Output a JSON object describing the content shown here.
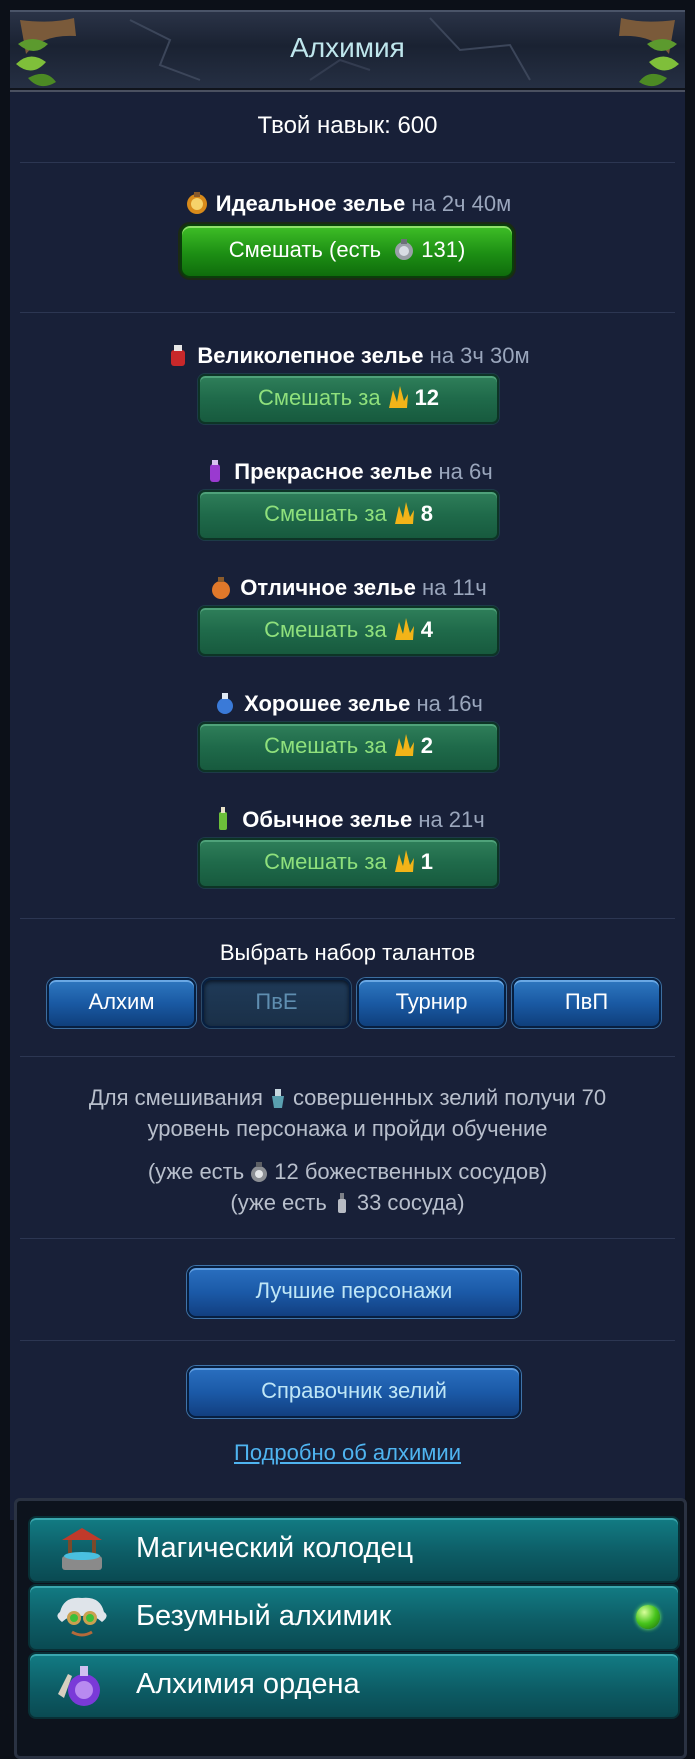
{
  "header": {
    "title": "Алхимия"
  },
  "skill_text": "Твой навык: 600",
  "ideal": {
    "name": "Идеальное зелье",
    "duration": "на 2ч 40м",
    "button_label": "Смешать (есть",
    "button_count": "131)"
  },
  "potions": [
    {
      "name": "Великолепное зелье",
      "duration": "на 3ч 30м",
      "button_label": "Смешать за",
      "cost": "12",
      "icon": "red-potion-icon"
    },
    {
      "name": "Прекрасное зелье",
      "duration": "на 6ч",
      "button_label": "Смешать за",
      "cost": "8",
      "icon": "purple-potion-icon"
    },
    {
      "name": "Отличное зелье",
      "duration": "на 11ч",
      "button_label": "Смешать за",
      "cost": "4",
      "icon": "orange-potion-icon"
    },
    {
      "name": "Хорошее зелье",
      "duration": "на 16ч",
      "button_label": "Смешать за",
      "cost": "2",
      "icon": "blue-potion-icon"
    },
    {
      "name": "Обычное зелье",
      "duration": "на 21ч",
      "button_label": "Смешать за",
      "cost": "1",
      "icon": "green-potion-icon"
    }
  ],
  "talents": {
    "title": "Выбрать набор талантов",
    "buttons": [
      "Алхим",
      "ПвЕ",
      "Турнир",
      "ПвП"
    ],
    "active": "ПвЕ"
  },
  "info": {
    "line1_a": "Для смешивания",
    "line1_b": "совершенных зелий получи 70",
    "line2": "уровень персонажа и пройди обучение",
    "line3_a": "(уже есть",
    "line3_b": "12 божественных сосудов)",
    "line4_a": "(уже есть",
    "line4_b": "33 сосуда)"
  },
  "buttons": {
    "best_characters": "Лучшие персонажи",
    "potion_guide": "Справочник зелий",
    "more_link": "Подробно об алхимии"
  },
  "menu": [
    {
      "label": "Магический колодец",
      "icon": "magic-well-icon"
    },
    {
      "label": "Безумный алхимик",
      "icon": "mad-alchemist-icon",
      "status": "green-dot"
    },
    {
      "label": "Алхимия ордена",
      "icon": "order-alchemy-icon"
    }
  ],
  "colors": {
    "panel_bg": "#182038",
    "mix_green": "#1d8f14",
    "mix_label": "#8fe07c",
    "blue_button": "#1b5aa8",
    "link": "#4fb4f0",
    "menu_teal": "#0d5d66"
  }
}
